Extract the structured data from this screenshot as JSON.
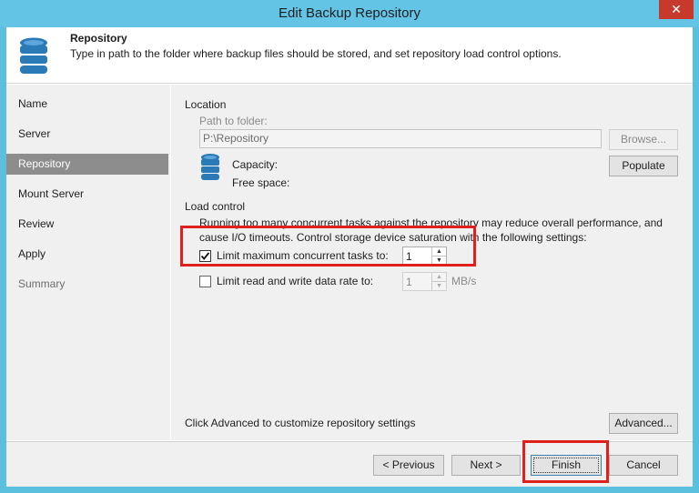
{
  "window": {
    "title": "Edit Backup Repository",
    "close_glyph": "✕"
  },
  "header": {
    "title": "Repository",
    "description": "Type in path to the folder where backup files should be stored, and set repository load control options.",
    "icon": "database-icon"
  },
  "sidebar": {
    "items": [
      {
        "label": "Name",
        "state": "normal"
      },
      {
        "label": "Server",
        "state": "normal"
      },
      {
        "label": "Repository",
        "state": "active"
      },
      {
        "label": "Mount Server",
        "state": "normal"
      },
      {
        "label": "Review",
        "state": "normal"
      },
      {
        "label": "Apply",
        "state": "normal"
      },
      {
        "label": "Summary",
        "state": "disabled"
      }
    ]
  },
  "location": {
    "section_title": "Location",
    "path_label": "Path to folder:",
    "path_value": "P:\\Repository",
    "browse_label": "Browse...",
    "capacity_label": "Capacity:",
    "free_space_label": "Free space:",
    "populate_label": "Populate"
  },
  "load_control": {
    "section_title": "Load control",
    "description_line1": "Running too many concurrent tasks against the repository may reduce overall performance, and",
    "description_line2": "cause I/O timeouts. Control storage device saturation with the following settings:",
    "limit_tasks": {
      "label": "Limit maximum concurrent tasks to:",
      "checked": true,
      "value": "1"
    },
    "limit_rate": {
      "label": "Limit read and write data rate to:",
      "checked": false,
      "value": "1",
      "unit": "MB/s"
    }
  },
  "advanced": {
    "hint": "Click Advanced to customize repository settings",
    "button_label": "Advanced..."
  },
  "footer": {
    "previous_label": "< Previous",
    "next_label": "Next >",
    "finish_label": "Finish",
    "cancel_label": "Cancel"
  },
  "colors": {
    "titlebar": "#63c4e6",
    "close": "#c7392b",
    "active_nav": "#8d8d8d",
    "highlight": "#e0201c",
    "icon_blue": "#2a7ab8"
  }
}
